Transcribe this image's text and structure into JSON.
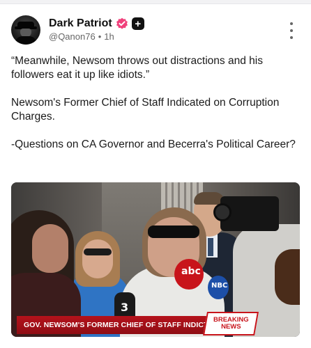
{
  "post": {
    "author": {
      "display_name": "Dark Patriot",
      "handle": "@Qanon76",
      "separator": "•",
      "time": "1h"
    },
    "paragraphs": [
      "“Meanwhile, Newsom throws out distractions and his followers eat it up like idiots.”",
      "Newsom's Former Chief of Staff Indicated on Corruption Charges.",
      "-Questions on CA Governor and Becerra's Political Career?"
    ],
    "media": {
      "chyron": "GOV. NEWSOM'S FORMER CHIEF OF STAFF INDICTED",
      "breaking": "BREAKING\nNEWS",
      "mic_labels": [
        "abc",
        "3",
        "NBC"
      ]
    }
  },
  "icons": {
    "verified": "verified-badge-icon",
    "plus": "plus-icon",
    "more": "more-vertical-icon"
  },
  "colors": {
    "verified_badge": "#f0417c",
    "breaking_red": "#c8141b"
  }
}
